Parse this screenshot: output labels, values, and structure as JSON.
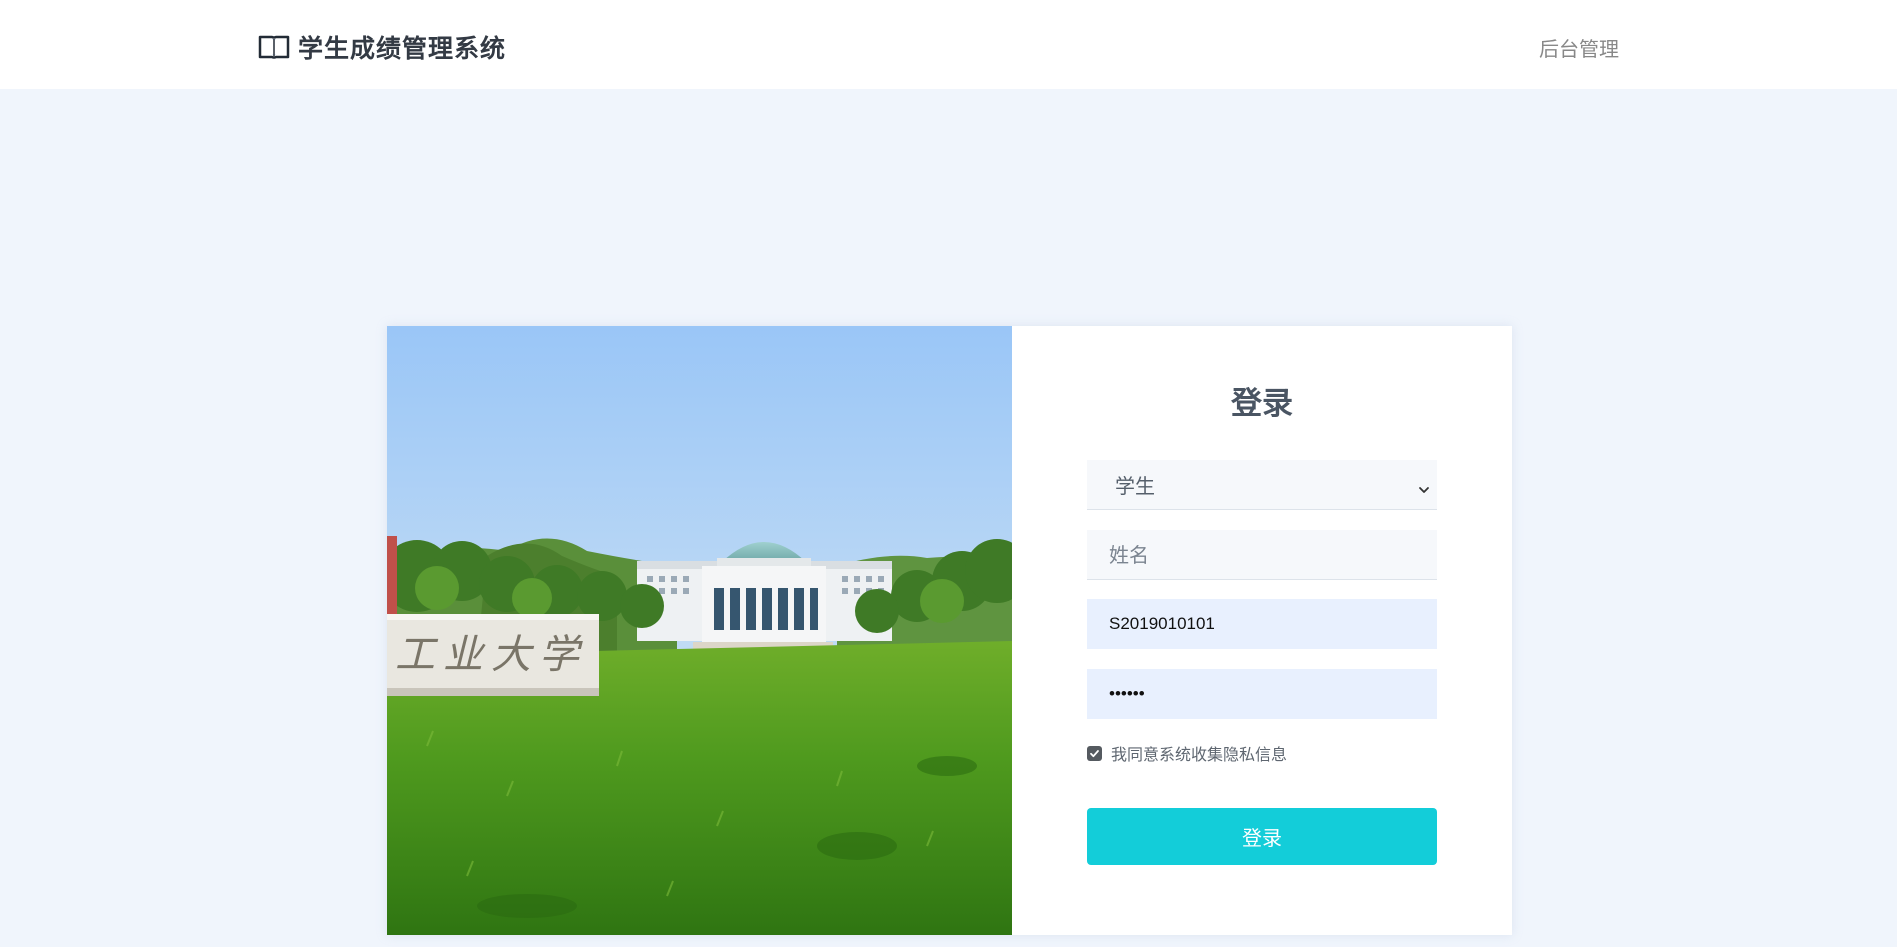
{
  "header": {
    "brand_icon": "open-book-icon",
    "title": "学生成绩管理系统",
    "admin_link": "后台管理"
  },
  "login": {
    "title": "登录",
    "role_select": {
      "selected": "学生",
      "icon": "chevron-down-icon"
    },
    "name_field": {
      "placeholder": "姓名",
      "value": ""
    },
    "id_field": {
      "value": "S2019010101"
    },
    "password_field": {
      "value": "••••••"
    },
    "agree": {
      "checked": true,
      "label": "我同意系统收集隐私信息"
    },
    "submit_label": "登录"
  },
  "photo": {
    "gate_inscription": "工业大学"
  },
  "colors": {
    "page_bg": "#f0f5fc",
    "accent": "#13cdd9",
    "autofill_bg": "#e8f0fe"
  }
}
